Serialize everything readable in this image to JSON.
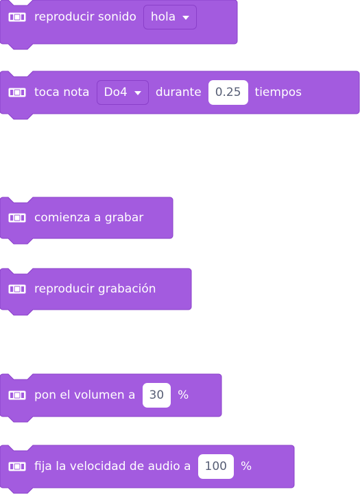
{
  "colors": {
    "block_fill": "#A35BDF",
    "block_stroke": "#8A3FC9",
    "text": "#FFFFFF",
    "input_text": "#575E75"
  },
  "icon": "music-extension-icon",
  "blocks": [
    {
      "parts": [
        "reproducir sonido"
      ],
      "dropdown": "hola"
    },
    {
      "label_a": "toca nota",
      "dropdown": "Do4",
      "label_b": "durante",
      "value": "0.25",
      "label_c": "tiempos"
    },
    {
      "label": "comienza a grabar"
    },
    {
      "label": "reproducir grabación"
    },
    {
      "label_a": "pon el volumen a",
      "value": "30",
      "label_b": "%"
    },
    {
      "label_a": "fija la velocidad de audio a",
      "value": "100",
      "label_b": "%"
    }
  ]
}
